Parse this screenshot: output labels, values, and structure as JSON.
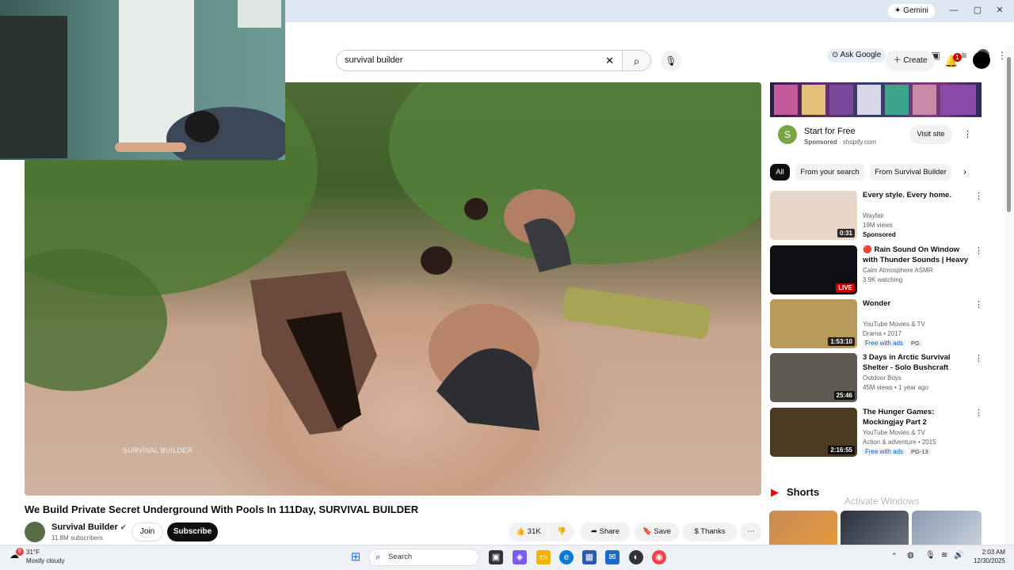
{
  "browser": {
    "gemini_label": "Gemini",
    "ask_google_label": "Ask Google"
  },
  "header": {
    "search_value": "survival builder",
    "create_label": "Create",
    "notification_count": "1"
  },
  "video": {
    "watermark": "SURVIVAL BUILDER",
    "title": "We Build Private Secret Underground With Pools In 111Day, SURVIVAL BUILDER",
    "channel_name": "Survival Builder",
    "subscribers": "11.8M subscribers",
    "join_label": "Join",
    "subscribe_label": "Subscribe",
    "likes": "31K",
    "share_label": "Share",
    "save_label": "Save",
    "thanks_label": "Thanks"
  },
  "ad": {
    "title": "Start for Free",
    "sponsored": "Sponsored",
    "domain": "shopify.com",
    "visit_label": "Visit site"
  },
  "chips": [
    "All",
    "From your search",
    "From Survival Builder"
  ],
  "recommendations": [
    {
      "title": "Every style. Every home.",
      "line1": "Wayfair",
      "line2": "19M views",
      "line3": "Sponsored",
      "duration": "0:31",
      "thumb_color": "#e8d7c8"
    },
    {
      "title": "🔴 Rain Sound On Window with Thunder Sounds | Heavy Rain ...",
      "line1": "Calm Atmosphere ASMR",
      "line2": "3.9K watching",
      "line3": "",
      "duration": "LIVE",
      "thumb_color": "#0e0f12"
    },
    {
      "title": "Wonder",
      "line1": "YouTube Movies & TV",
      "line2": "Drama • 2017",
      "line3": "Free with ads",
      "badge": "PG",
      "duration": "1:53:10",
      "thumb_color": "#b89a5a"
    },
    {
      "title": "3 Days in Arctic Survival Shelter - Solo Bushcraft Camping & ...",
      "line1": "Outdoor Boys",
      "line2": "45M views • 1 year ago",
      "line3": "",
      "duration": "25:46",
      "thumb_color": "#5e5a52"
    },
    {
      "title": "The Hunger Games: Mockingjay Part 2",
      "line1": "YouTube Movies & TV",
      "line2": "Action & adventure • 2015",
      "line3": "Free with ads",
      "badge": "PG-13",
      "duration": "2:16:55",
      "thumb_color": "#4a3a22"
    }
  ],
  "shorts": {
    "label": "Shorts"
  },
  "activate_windows": "Activate Windows",
  "taskbar": {
    "weather_temp": "31°F",
    "weather_desc": "Mostly cloudy",
    "weather_alert": "6",
    "search_label": "Search",
    "time": "2:03 AM",
    "date": "12/30/2025"
  }
}
